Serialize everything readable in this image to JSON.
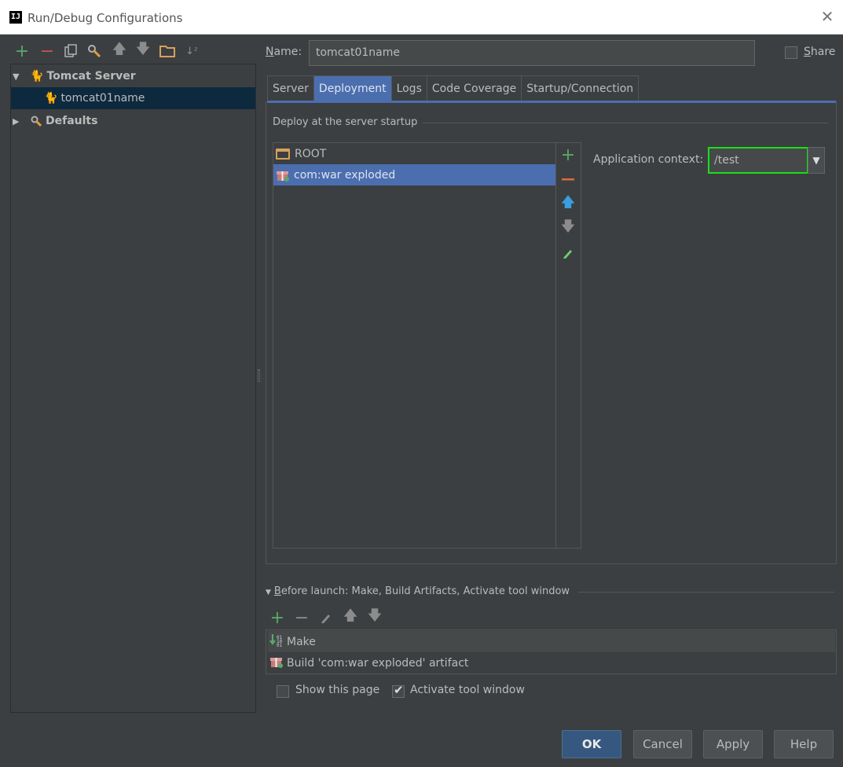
{
  "window": {
    "title": "Run/Debug Configurations",
    "app_icon": "IJ"
  },
  "toolbar": {
    "icons": [
      "add-icon",
      "remove-icon",
      "copy-icon",
      "edit-defaults-icon",
      "move-up-icon",
      "move-down-icon",
      "folder-icon",
      "sort-icon"
    ]
  },
  "tree": {
    "group": "Tomcat Server",
    "item": "tomcat01name",
    "defaults": "Defaults"
  },
  "name_label_prefix": "N",
  "name_label_rest": "ame:",
  "name_value": "tomcat01name",
  "share_prefix": "S",
  "share_rest": "hare",
  "tabs": [
    "Server",
    "Deployment",
    "Logs",
    "Code Coverage",
    "Startup/Connection"
  ],
  "deploy": {
    "section_label": "Deploy at the server startup",
    "items": [
      "ROOT",
      "com:war exploded"
    ],
    "context_label": "Application context:",
    "context_value": "/test"
  },
  "before_launch": {
    "label_prefix": "B",
    "label_rest": "efore launch: Make, Build Artifacts, Activate tool window",
    "items": [
      "Make",
      "Build 'com:war exploded' artifact"
    ]
  },
  "checkboxes": {
    "show_page": {
      "label": "Show this page",
      "checked": false
    },
    "activate_tool": {
      "label": "Activate tool window",
      "checked": true
    }
  },
  "buttons": {
    "ok": "OK",
    "cancel": "Cancel",
    "apply": "Apply",
    "help": "Help"
  },
  "colors": {
    "accent": "#4b6eaf",
    "highlight": "#18e018",
    "background": "#3c3f41"
  }
}
